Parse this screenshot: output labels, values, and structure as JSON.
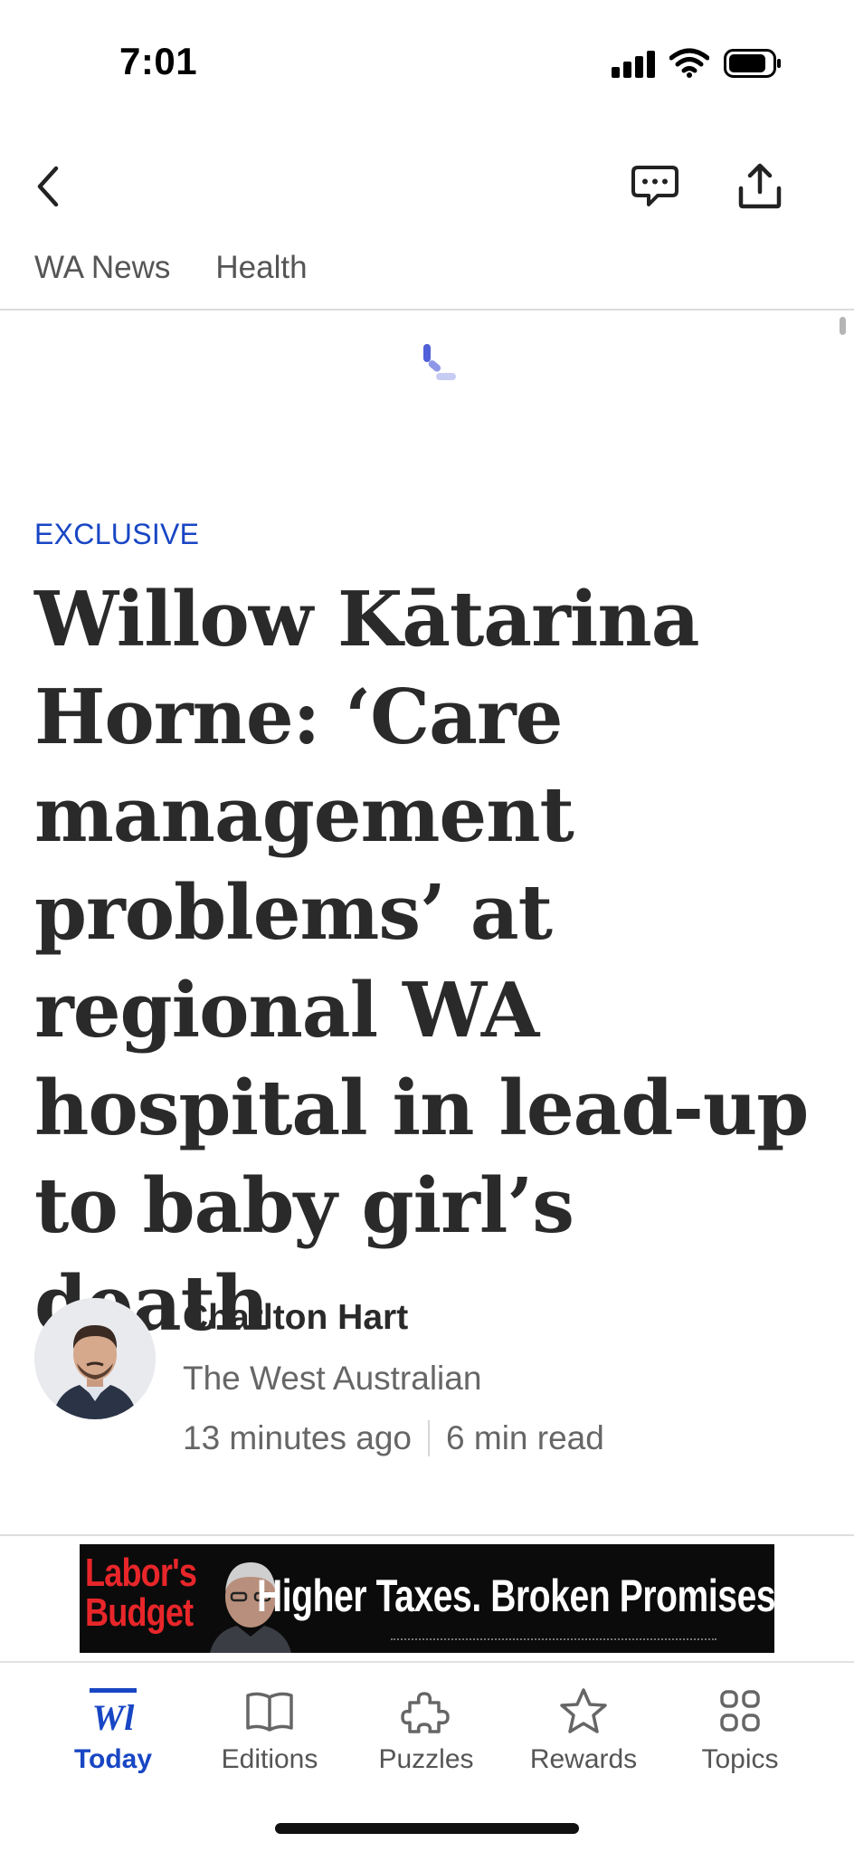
{
  "status_bar": {
    "time": "7:01"
  },
  "breadcrumb": [
    "WA News",
    "Health"
  ],
  "article": {
    "kicker": "EXCLUSIVE",
    "headline": "Willow Kātarina Horne: ‘Care management problems’ at regional WA hospital in lead-up to baby girl’s death",
    "author": "Charlton Hart",
    "publication": "The West Australian",
    "time_ago": "13 minutes ago",
    "read_time": "6 min read"
  },
  "ad": {
    "left_text_line1": "Labor's",
    "left_text_line2": "Budget",
    "main_text": "Higher Taxes. Broken Promises."
  },
  "tabs": [
    {
      "label": "Today",
      "icon": "today-logo-icon",
      "active": true
    },
    {
      "label": "Editions",
      "icon": "book-icon",
      "active": false
    },
    {
      "label": "Puzzles",
      "icon": "puzzle-icon",
      "active": false
    },
    {
      "label": "Rewards",
      "icon": "star-icon",
      "active": false
    },
    {
      "label": "Topics",
      "icon": "grid-icon",
      "active": false
    }
  ],
  "colors": {
    "accent": "#1846c4",
    "text": "#2a2a2a",
    "muted": "#666666",
    "ad_red": "#e8262a"
  }
}
